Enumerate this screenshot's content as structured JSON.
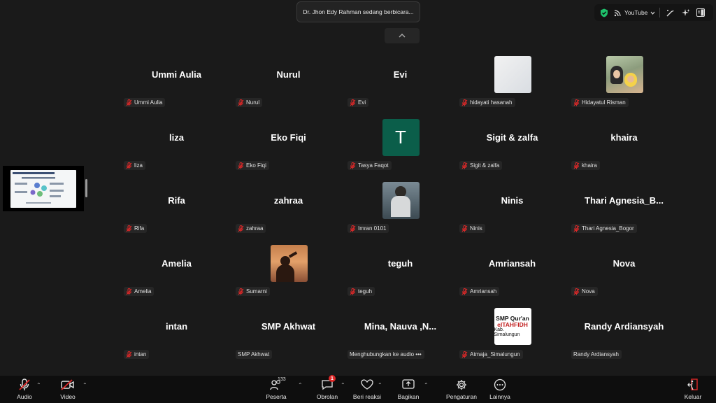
{
  "speaker_banner": "Dr. Jhon Edy Rahman sedang berbicara...",
  "top_right": {
    "stream_label": "YouTube"
  },
  "tiles": [
    {
      "big": "Ummi Aulia",
      "label": "Ummi Aulia",
      "muted": true,
      "avatar": null
    },
    {
      "big": "Nurul",
      "label": "Nurul",
      "muted": true,
      "avatar": null
    },
    {
      "big": "Evi",
      "label": "Evi",
      "muted": true,
      "avatar": null
    },
    {
      "big": "",
      "label": "hidayati hasanah",
      "muted": true,
      "avatar": "blank-photo"
    },
    {
      "big": "",
      "label": "Hidayatul Risman",
      "muted": true,
      "avatar": "family-photo"
    },
    {
      "big": "liza",
      "label": "liza",
      "muted": true,
      "avatar": null
    },
    {
      "big": "Eko Fiqi",
      "label": "Eko Fiqi",
      "muted": true,
      "avatar": null
    },
    {
      "big": "",
      "label": "Tasya Faqot",
      "muted": true,
      "avatar": "letter-t",
      "avatar_letter": "T"
    },
    {
      "big": "Sigit & zalfa",
      "label": "Sigit & zalfa",
      "muted": true,
      "avatar": null
    },
    {
      "big": "khaira",
      "label": "khaira",
      "muted": true,
      "avatar": null
    },
    {
      "big": "Rifa",
      "label": "Rifa",
      "muted": true,
      "avatar": null
    },
    {
      "big": "zahraa",
      "label": "zahraa",
      "muted": true,
      "avatar": null
    },
    {
      "big": "",
      "label": "Imran 0101",
      "muted": true,
      "avatar": "person-photo"
    },
    {
      "big": "Ninis",
      "label": "Ninis",
      "muted": true,
      "avatar": null
    },
    {
      "big": "Thari  Agnesia_B...",
      "label": "Thari Agnesia_Bogor",
      "muted": true,
      "avatar": null
    },
    {
      "big": "Amelia",
      "label": "Amelia",
      "muted": true,
      "avatar": null
    },
    {
      "big": "",
      "label": "Sumarni",
      "muted": true,
      "avatar": "sunset-photo"
    },
    {
      "big": "teguh",
      "label": "teguh",
      "muted": true,
      "avatar": null
    },
    {
      "big": "Amriansah",
      "label": "Amriansah",
      "muted": true,
      "avatar": null
    },
    {
      "big": "Nova",
      "label": "Nova",
      "muted": true,
      "avatar": null
    },
    {
      "big": "intan",
      "label": "intan",
      "muted": true,
      "avatar": null
    },
    {
      "big": "SMP Akhwat",
      "label": "SMP Akhwat",
      "muted": false,
      "avatar": null
    },
    {
      "big": "Mina, Nauva ,N...",
      "label": "Menghubungkan ke audio •••",
      "muted": false,
      "avatar": null
    },
    {
      "big": "",
      "label": "Atmaja_Simalungun",
      "muted": true,
      "avatar": "school-logo",
      "logo_lines": [
        "SMP Qur'an",
        "eITAHFIDH",
        "Kab. Simalungun"
      ]
    },
    {
      "big": "Randy Ardiansyah",
      "label": "Randy Ardiansyah",
      "muted": false,
      "avatar": null
    }
  ],
  "toolbar": {
    "audio": "Audio",
    "video": "Video",
    "participants": "Peserta",
    "participants_count": "133",
    "chat": "Obrolan",
    "chat_badge": "1",
    "reactions": "Beri reaksi",
    "share": "Bagikan",
    "settings": "Pengaturan",
    "more": "Lainnya",
    "leave": "Keluar"
  },
  "colors": {
    "background": "#1a1a1a",
    "toolbar": "#0e0e0e",
    "muted_red": "#e02828",
    "badge_red": "#e02828",
    "shield_green": "#1ec16b",
    "tasya_avatar": "#0b5e4a"
  }
}
